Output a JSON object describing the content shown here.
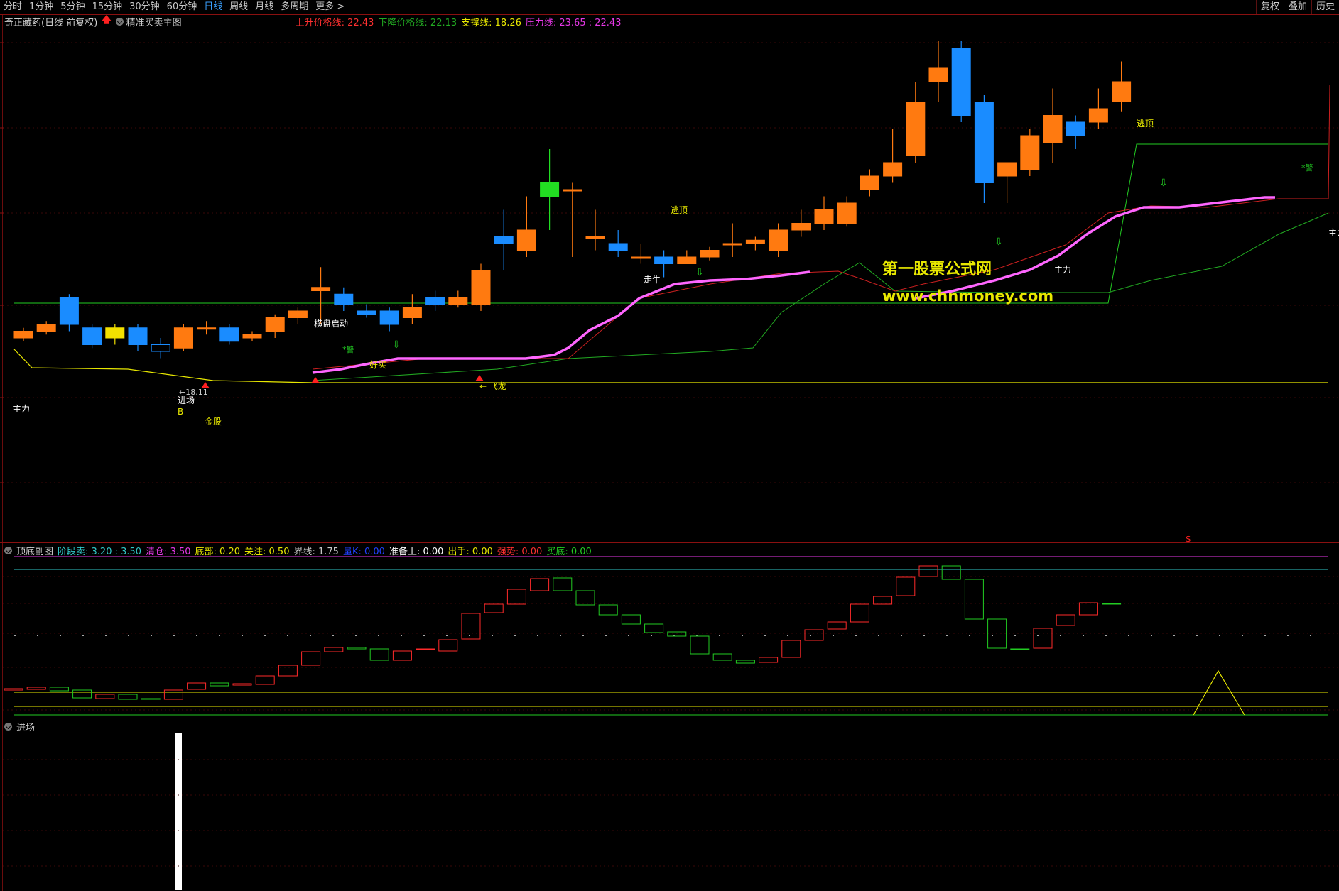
{
  "timeframes": [
    "分时",
    "1分钟",
    "5分钟",
    "15分钟",
    "30分钟",
    "60分钟",
    "日线",
    "周线",
    "月线",
    "多周期",
    "更多 >"
  ],
  "active_timeframe": "日线",
  "right_buttons": [
    "复权",
    "叠加",
    "历史"
  ],
  "stock": {
    "name": "奇正藏药(日线 前复权)",
    "indicator": "精准买卖主图"
  },
  "main_readouts": [
    {
      "label": "上升价格线: ",
      "value": "22.43",
      "color": "#ff3030"
    },
    {
      "label": "下降价格线: ",
      "value": "22.13",
      "color": "#22aa22"
    },
    {
      "label": "支撑线: ",
      "value": "18.26",
      "color": "#e8e800"
    },
    {
      "label": "压力线: ",
      "value": "23.65 : 22.43",
      "color": "#e838e8"
    }
  ],
  "main_annotations": {
    "zhuli_left": "主力",
    "entry": "进场",
    "entry_b": "B",
    "price_low": "←18.11",
    "jingu": "金股",
    "hengpan": "横盘启动",
    "haomai": "好买",
    "jing1": "*警",
    "feilong": "← 飞龙",
    "zouniu": "走牛",
    "taoding1": "逃顶",
    "taoding2": "逃顶",
    "zhuli_mid": "主力",
    "jing2": "*警",
    "zhuli_right": "主力",
    "watermark1": "第一股票公式网",
    "watermark2": "www.chnmoney.com"
  },
  "sub_panel": {
    "title": "顶底副图",
    "readouts": [
      {
        "label": "阶段卖: ",
        "value": "3.20 : 3.50",
        "color": "#30c8c8"
      },
      {
        "label": "清仓: ",
        "value": "3.50",
        "color": "#e838e8"
      },
      {
        "label": "底部: ",
        "value": "0.20",
        "color": "#e8e800"
      },
      {
        "label": "关注: ",
        "value": "0.50",
        "color": "#e8e800"
      },
      {
        "label": "界线: ",
        "value": "1.75",
        "color": "#c8c8c8"
      },
      {
        "label": "量K: ",
        "value": "0.00",
        "color": "#2040ff"
      },
      {
        "label": "准备上: ",
        "value": "0.00",
        "color": "#ffffff"
      },
      {
        "label": "出手: ",
        "value": "0.00",
        "color": "#e8e800"
      },
      {
        "label": "强势: ",
        "value": "0.00",
        "color": "#ff3030"
      },
      {
        "label": "买底: ",
        "value": "0.00",
        "color": "#22cc22"
      }
    ],
    "dollar_mark": "$"
  },
  "bottom_panel": {
    "title": "进场"
  },
  "colors": {
    "up": "#ff7a10",
    "down": "#1a8cff",
    "ma": "#ff66ff",
    "support": "#e8e800",
    "green_line": "#22aa22",
    "frame": "#8a1010"
  }
}
